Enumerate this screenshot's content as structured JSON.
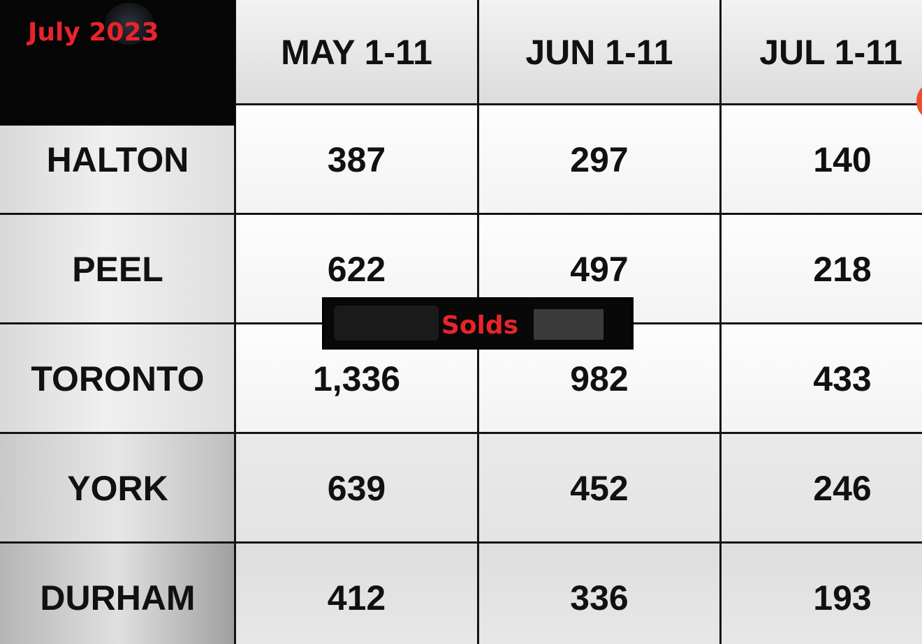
{
  "overlay": {
    "title": "July 2023",
    "label": "Solds",
    "accent_color": "#e8242a"
  },
  "table": {
    "columns": [
      "MAY 1-11",
      "JUN 1-11",
      "JUL 1-11"
    ],
    "rows": [
      {
        "region": "HALTON",
        "values": [
          "387",
          "297",
          "140"
        ]
      },
      {
        "region": "PEEL",
        "values": [
          "622",
          "497",
          "218"
        ]
      },
      {
        "region": "TORONTO",
        "values": [
          "1,336",
          "982",
          "433"
        ]
      },
      {
        "region": "YORK",
        "values": [
          "639",
          "452",
          "246"
        ]
      },
      {
        "region": "DURHAM",
        "values": [
          "412",
          "336",
          "193"
        ]
      }
    ]
  }
}
